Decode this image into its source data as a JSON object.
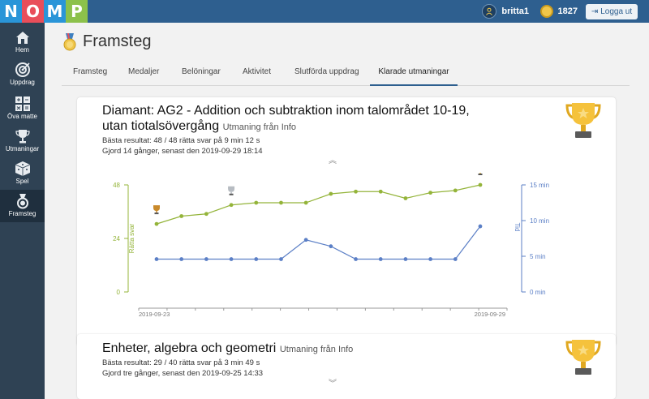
{
  "logo": [
    "N",
    "O",
    "M",
    "P"
  ],
  "logo_colors": [
    "#2a95d8",
    "#e94e5a",
    "#2a95d8",
    "#8cc14b"
  ],
  "header": {
    "username": "britta1",
    "coins": "1827",
    "logout_label": "Logga ut"
  },
  "sidebar": {
    "items": [
      {
        "label": "Hem",
        "icon": "home-icon"
      },
      {
        "label": "Uppdrag",
        "icon": "target-icon"
      },
      {
        "label": "Öva matte",
        "icon": "operations-icon"
      },
      {
        "label": "Utmaningar",
        "icon": "trophy-icon"
      },
      {
        "label": "Spel",
        "icon": "dice-icon"
      },
      {
        "label": "Framsteg",
        "icon": "medal-icon",
        "active": true
      }
    ]
  },
  "page": {
    "title": "Framsteg"
  },
  "tabs": [
    {
      "label": "Framsteg"
    },
    {
      "label": "Medaljer"
    },
    {
      "label": "Belöningar"
    },
    {
      "label": "Aktivitet"
    },
    {
      "label": "Slutförda uppdrag"
    },
    {
      "label": "Klarade utmaningar",
      "active": true
    }
  ],
  "cards": [
    {
      "title": "Diamant: AG2 - Addition och subtraktion inom talområdet 10-19, utan tiotalsövergång",
      "subtitle": "Utmaning från Info",
      "best": "Bästa resultat: 48 / 48 rätta svar på 9 min 12 s",
      "done": "Gjord 14 gånger, senast den 2019-09-29 18:14"
    },
    {
      "title": "Enheter, algebra och geometri",
      "subtitle": "Utmaning från Info",
      "best": "Bästa resultat: 29 / 40 rätta svar på 3 min 49 s",
      "done": "Gjord tre gånger, senast den 2019-09-25 14:33"
    }
  ],
  "chart_data": {
    "type": "line",
    "x": [
      1,
      2,
      3,
      4,
      5,
      6,
      7,
      8,
      9,
      10,
      11,
      12,
      13,
      14
    ],
    "x_tick_labels": [
      "2019-09-23",
      "2019-09-29"
    ],
    "left_axis": {
      "label": "Rätta svar",
      "ticks": [
        "0",
        "24",
        "48"
      ],
      "range": [
        0,
        48
      ],
      "color": "#94b43a"
    },
    "right_axis": {
      "label": "Tid",
      "ticks": [
        "0 min",
        "5 min",
        "10 min",
        "15 min"
      ],
      "range": [
        0,
        15
      ],
      "color": "#5b7fc6"
    },
    "series": [
      {
        "axis": "left",
        "color": "#94b43a",
        "values": [
          30.5,
          34,
          35,
          39,
          40,
          40,
          40,
          44,
          45,
          45,
          42,
          44.5,
          45.5,
          48
        ]
      },
      {
        "axis": "right",
        "color": "#5b7fc6",
        "values": [
          4.6,
          4.6,
          4.6,
          4.6,
          4.6,
          4.6,
          7.3,
          6.4,
          4.6,
          4.6,
          4.6,
          4.6,
          4.6,
          9.2
        ]
      }
    ],
    "awards": [
      {
        "index": 1,
        "kind": "bronze-trophy"
      },
      {
        "index": 4,
        "kind": "silver-trophy"
      },
      {
        "index": 14,
        "kind": "gold-trophy"
      }
    ]
  }
}
